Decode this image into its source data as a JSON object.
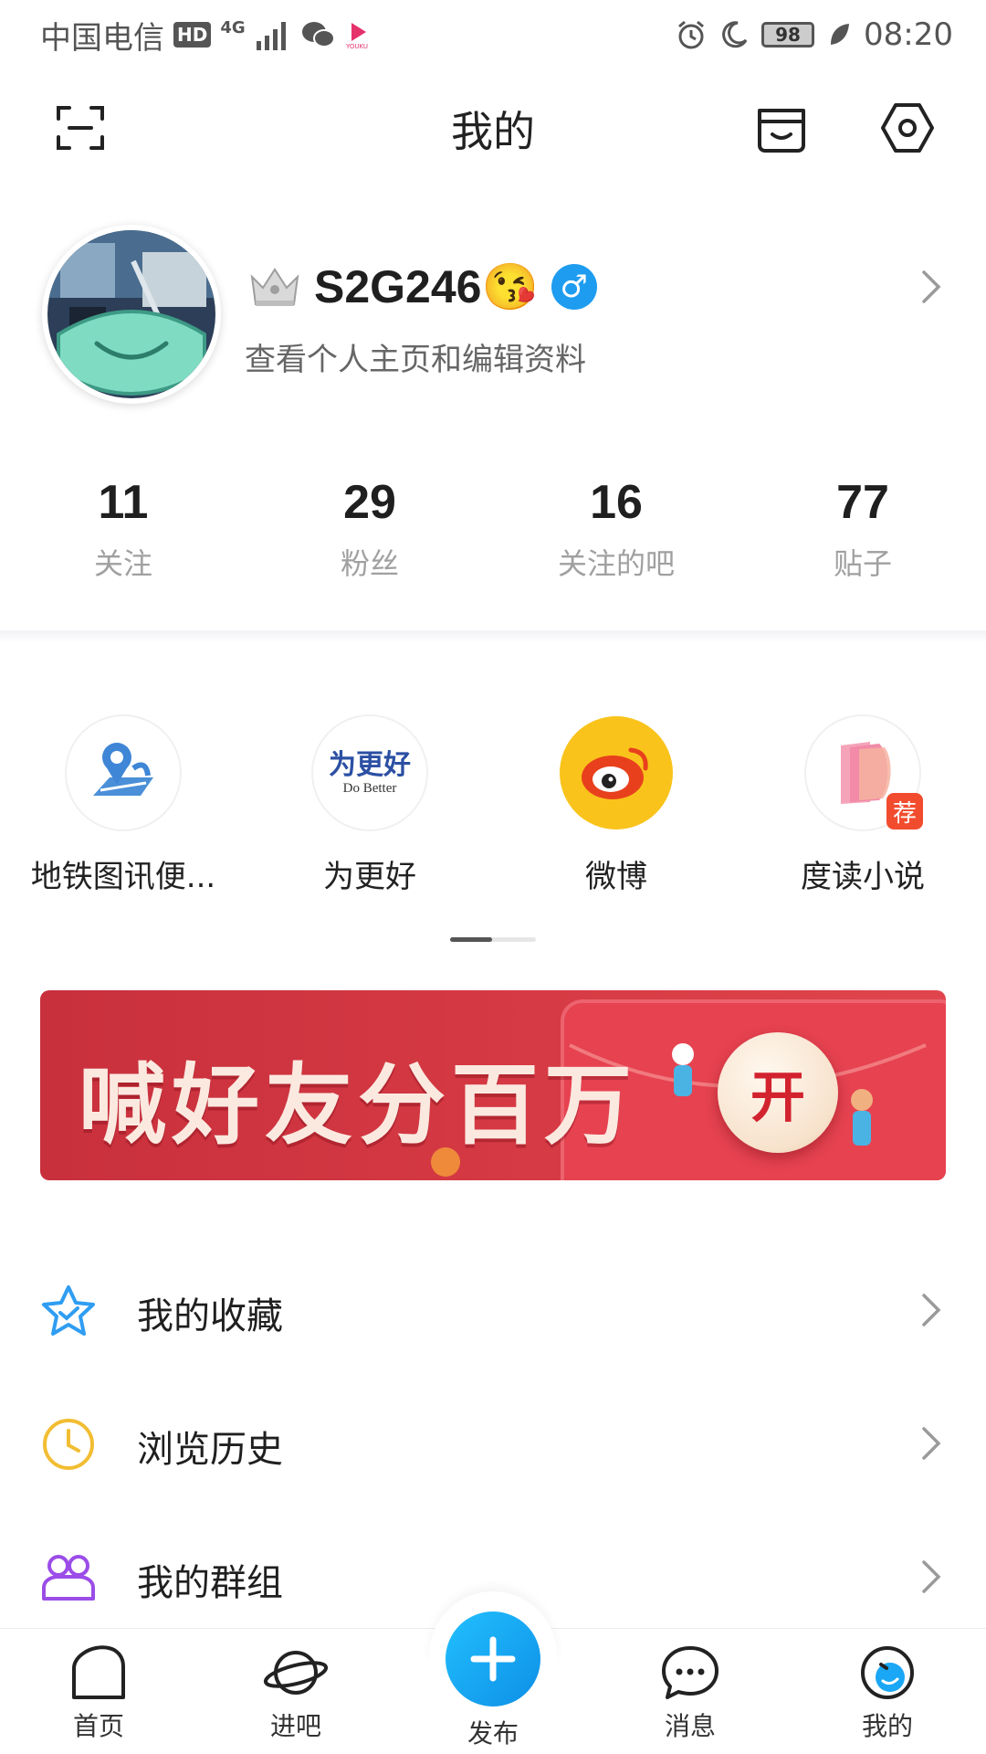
{
  "status_bar": {
    "carrier": "中国电信",
    "hd_badge": "HD",
    "network": "4G",
    "battery": "98",
    "time": "08:20"
  },
  "header": {
    "title": "我的"
  },
  "profile": {
    "username": "S2G246😘",
    "subtitle": "查看个人主页和编辑资料",
    "gender_symbol": "♂"
  },
  "stats": [
    {
      "value": "11",
      "label": "关注"
    },
    {
      "value": "29",
      "label": "粉丝"
    },
    {
      "value": "16",
      "label": "关注的吧"
    },
    {
      "value": "77",
      "label": "贴子"
    }
  ],
  "apps": [
    {
      "label": "地铁图讯便...",
      "icon": "map-pin-icon"
    },
    {
      "label": "为更好",
      "icon": "do-better-logo",
      "logo_text": "为更好",
      "logo_sub": "Do Better"
    },
    {
      "label": "微博",
      "icon": "weibo-icon"
    },
    {
      "label": "度读小说",
      "icon": "book-icon",
      "badge": "荐"
    }
  ],
  "banner": {
    "title": "喊好友分百万",
    "button": "开"
  },
  "menu": [
    {
      "label": "我的收藏",
      "icon": "star-icon",
      "color": "#2f9df2"
    },
    {
      "label": "浏览历史",
      "icon": "clock-icon",
      "color": "#f2bd32"
    },
    {
      "label": "我的群组",
      "icon": "group-icon",
      "color": "#9b4de8"
    }
  ],
  "bottom_nav": {
    "home": "首页",
    "explore": "进吧",
    "publish": "发布",
    "messages": "消息",
    "mine": "我的"
  },
  "colors": {
    "accent": "#1aa7f5",
    "banner_red": "#d2323e"
  }
}
